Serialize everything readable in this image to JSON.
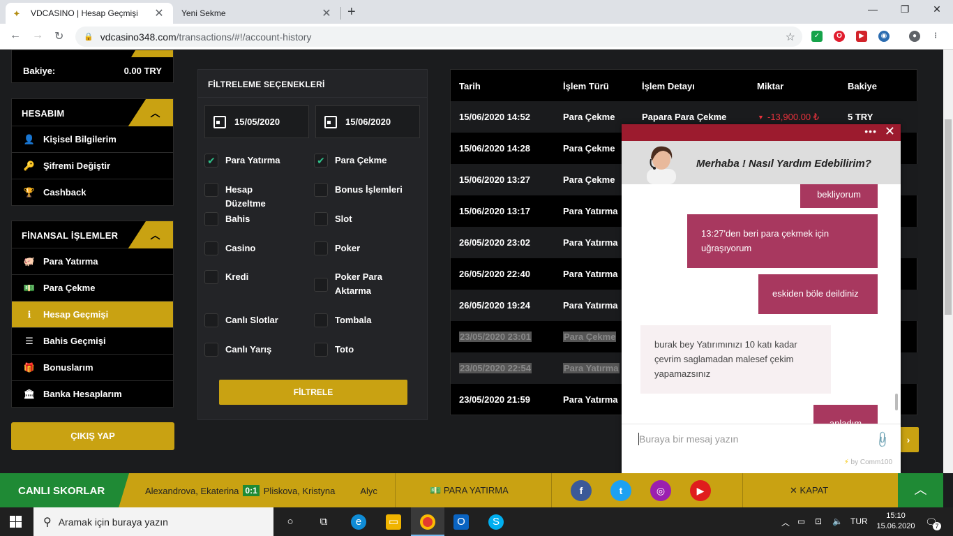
{
  "browser": {
    "tabs": [
      {
        "title": "VDCASINO | Hesap Geçmişi"
      },
      {
        "title": "Yeni Sekme"
      }
    ],
    "url_domain": "vdcasino348.com",
    "url_path": "/transactions/#!/account-history"
  },
  "sidebar": {
    "balance_label": "Bakiye:",
    "balance_value": "0.00 TRY",
    "account_title": "HESABIM",
    "account_items": [
      {
        "label": "Kişisel Bilgilerim",
        "icon": "user-icon"
      },
      {
        "label": "Şifremi Değiştir",
        "icon": "key-icon"
      },
      {
        "label": "Cashback",
        "icon": "trophy-icon"
      }
    ],
    "finance_title": "FİNANSAL İŞLEMLER",
    "finance_items": [
      {
        "label": "Para Yatırma",
        "icon": "piggy-bank-icon"
      },
      {
        "label": "Para Çekme",
        "icon": "money-icon"
      },
      {
        "label": "Hesap Geçmişi",
        "icon": "info-icon",
        "active": true
      },
      {
        "label": "Bahis Geçmişi",
        "icon": "list-icon"
      },
      {
        "label": "Bonuslarım",
        "icon": "gift-icon"
      },
      {
        "label": "Banka Hesaplarım",
        "icon": "bank-icon"
      }
    ],
    "logout_label": "ÇIKIŞ YAP"
  },
  "filter": {
    "title": "FİLTRELEME SEÇENEKLERİ",
    "date_from": "15/05/2020",
    "date_to": "15/06/2020",
    "options": [
      {
        "label": "Para Yatırma",
        "checked": true
      },
      {
        "label": "Para Çekme",
        "checked": true
      },
      {
        "label": "Hesap Düzeltme",
        "checked": false
      },
      {
        "label": "Bonus İşlemleri",
        "checked": false
      },
      {
        "label": "Bahis",
        "checked": false
      },
      {
        "label": "Slot",
        "checked": false
      },
      {
        "label": "Casino",
        "checked": false
      },
      {
        "label": "Poker",
        "checked": false
      },
      {
        "label": "Kredi",
        "checked": false
      },
      {
        "label": "Poker Para Aktarma",
        "checked": false
      },
      {
        "label": "Canlı Slotlar",
        "checked": false
      },
      {
        "label": "Tombala",
        "checked": false
      },
      {
        "label": "Canlı Yarış",
        "checked": false
      },
      {
        "label": "Toto",
        "checked": false
      }
    ],
    "button_label": "FİLTRELE"
  },
  "table": {
    "headers": [
      "Tarih",
      "İşlem Türü",
      "İşlem Detayı",
      "Miktar",
      "Bakiye"
    ],
    "rows": [
      {
        "date": "15/06/2020 14:52",
        "type": "Para Çekme",
        "detail": "Papara Para Çekme",
        "amount": "-13,900.00 ₺",
        "balance": "5 TRY"
      },
      {
        "date": "15/06/2020 14:28",
        "type": "Para Çekme"
      },
      {
        "date": "15/06/2020 13:27",
        "type": "Para Çekme"
      },
      {
        "date": "15/06/2020 13:17",
        "type": "Para Yatırma"
      },
      {
        "date": "26/05/2020 23:02",
        "type": "Para Yatırma"
      },
      {
        "date": "26/05/2020 22:40",
        "type": "Para Yatırma"
      },
      {
        "date": "26/05/2020 19:24",
        "type": "Para Yatırma"
      },
      {
        "date": "23/05/2020 23:01",
        "type": "Para Çekme",
        "selected": true
      },
      {
        "date": "23/05/2020 22:54",
        "type": "Para Yatırma",
        "selected": true
      },
      {
        "date": "23/05/2020 21:59",
        "type": "Para Yatırma"
      }
    ]
  },
  "chat": {
    "greeting": "Merhaba ! Nasıl Yardım Edebilirim?",
    "messages": [
      {
        "dir": "out",
        "text": "bekliyorum"
      },
      {
        "dir": "out",
        "text": "13:27'den beri para çekmek için uğraşıyorum"
      },
      {
        "dir": "out",
        "text": "eskiden böle deildiniz"
      },
      {
        "dir": "in",
        "text": "burak bey Yatırımınızı 10 katı kadar çevrim saglamadan malesef çekim yapamazsınız"
      },
      {
        "dir": "out",
        "text": "anladım"
      }
    ],
    "input_placeholder": "Buraya bir mesaj yazın",
    "powered_by": "by Comm100"
  },
  "bottombar": {
    "live_label": "CANLI SKORLAR",
    "ticker_home": "Alexandrova, Ekaterina",
    "ticker_score": "0:1",
    "ticker_away": "Pliskova, Kristyna",
    "ticker_next": "Alyc",
    "deposit_label": "PARA YATIRMA",
    "close_label": "KAPAT"
  },
  "taskbar": {
    "search_placeholder": "Aramak için buraya yazın",
    "lang": "TUR",
    "time": "15:10",
    "date": "15.06.2020",
    "notif_count": "7"
  },
  "colors": {
    "accent_gold": "#c9a212",
    "live_green": "#1f8a35",
    "chat_header": "#9c1b2e",
    "chat_bubble_out": "#a8385f",
    "negative_red": "#e8323c"
  }
}
